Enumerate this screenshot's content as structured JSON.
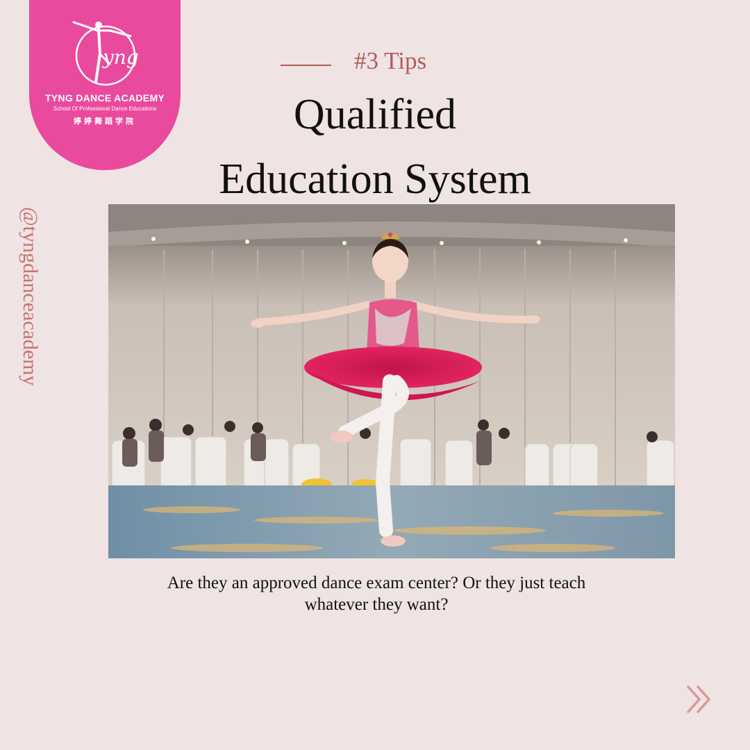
{
  "brand": {
    "name": "TYNG DANCE ACADEMY",
    "tagline": "School Of Professional Dance Educations",
    "chinese_name": "婷婷舞蹈学院",
    "logo_script": "Tyng",
    "badge_color": "#ea4a9d",
    "handle": "@tyngdanceacademy"
  },
  "header": {
    "tip_label": "#3 Tips",
    "title_line1": "Qualified",
    "title_line2": "Education System"
  },
  "photo": {
    "subject": "young ballerina in pink tutu performing on a ballroom stage"
  },
  "caption": {
    "line1": "Are they an approved dance exam center? Or they just teach",
    "line2": "whatever they want?"
  },
  "navigation": {
    "next_icon": "double-chevron-right-icon"
  },
  "colors": {
    "background": "#efe3e3",
    "accent": "#b25d59",
    "handle": "#c87470",
    "text": "#111111"
  }
}
